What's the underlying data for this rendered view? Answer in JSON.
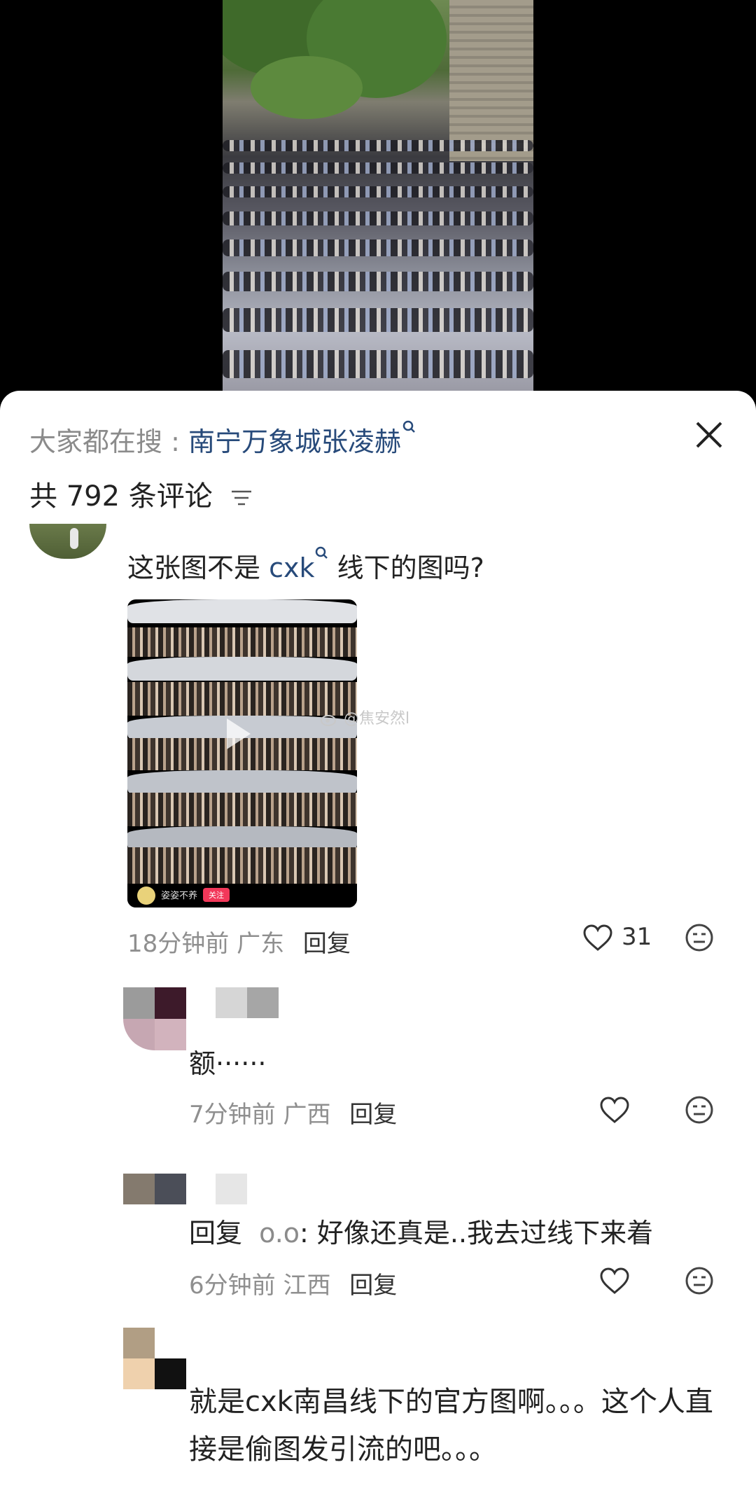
{
  "search_bar": {
    "label": "大家都在搜 :",
    "term": "南宁万象城张凌赫"
  },
  "comment_count_text": "共 792 条评论",
  "main_comment": {
    "text_before": "这张图不是",
    "keyword": "cxk",
    "text_after": "线下的图吗?",
    "image": {
      "watermark": "@焦安然l",
      "footer_username": "姿姿不养",
      "footer_follow": "关注"
    },
    "time": "18分钟前",
    "location": "广东",
    "reply_label": "回复",
    "likes": "31"
  },
  "replies": [
    {
      "text": "额······",
      "time": "7分钟前",
      "location": "广西",
      "reply_label": "回复"
    },
    {
      "reply_prefix": "回复",
      "reply_to": "o.o",
      "text": ":  好像还真是..我去过线下来着",
      "time": "6分钟前",
      "location": "江西",
      "reply_label": "回复"
    },
    {
      "text": "就是cxk南昌线下的官方图啊。。。这个人直接是偷图发引流的吧。。。"
    }
  ],
  "colors": {
    "keyword": "#274a7a",
    "muted": "#8b8b8b",
    "text": "#222222"
  }
}
